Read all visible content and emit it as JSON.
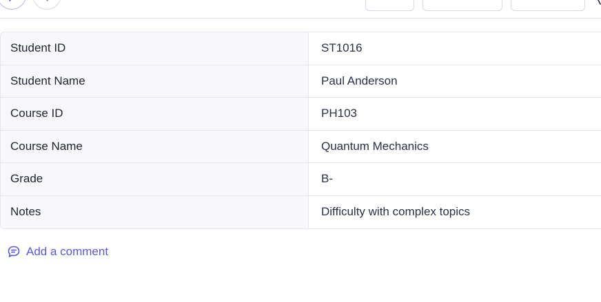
{
  "toolbar": {
    "buttons": [
      {
        "label": ""
      },
      {
        "label": ""
      },
      {
        "label": ""
      }
    ]
  },
  "record": {
    "rows": [
      {
        "label": "Student ID",
        "value": "ST1016"
      },
      {
        "label": "Student Name",
        "value": "Paul Anderson"
      },
      {
        "label": "Course ID",
        "value": "PH103"
      },
      {
        "label": "Course Name",
        "value": "Quantum Mechanics"
      },
      {
        "label": "Grade",
        "value": "B-"
      },
      {
        "label": "Notes",
        "value": "Difficulty with complex topics"
      }
    ]
  },
  "comments": {
    "add_label": "Add a comment"
  },
  "colors": {
    "accent": "#5b57d9",
    "border": "#e6e7ee",
    "label_bg": "#f8f8fc"
  },
  "icons": {
    "prev": "chevron-left-icon",
    "next": "chevron-right-icon",
    "comment": "comment-icon",
    "more": "more-icon"
  }
}
